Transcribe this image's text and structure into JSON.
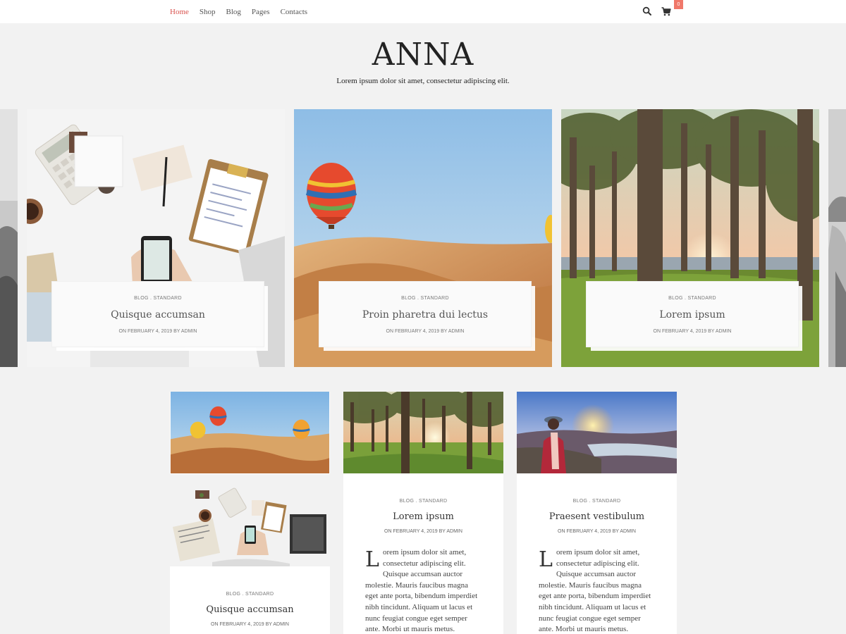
{
  "nav": {
    "items": [
      {
        "label": "Home",
        "active": true
      },
      {
        "label": "Shop"
      },
      {
        "label": "Blog"
      },
      {
        "label": "Pages"
      },
      {
        "label": "Contacts"
      }
    ],
    "cart_count": "0",
    "accent_color": "#d9534f",
    "badge_color": "#f0786a",
    "icons": [
      "search-icon",
      "cart-icon"
    ]
  },
  "header": {
    "logo": "ANNA",
    "tagline": "Lorem ipsum dolor sit amet, consectetur adipiscing elit."
  },
  "slider": [
    {
      "category": "BLOG",
      "category2": "STANDARD",
      "title": "Quisque accumsan",
      "meta": "ON FEBRUARY 4, 2019 BY ADMIN",
      "image": "desk with calculator, clipboard and phone"
    },
    {
      "category": "BLOG",
      "category2": "STANDARD",
      "title": "Proin pharetra dui lectus",
      "meta": "ON FEBRUARY 4, 2019 BY ADMIN",
      "image": "hot air balloons over desert"
    },
    {
      "category": "BLOG",
      "category2": "STANDARD",
      "title": "Lorem ipsum",
      "meta": "ON FEBRUARY 4, 2019 BY ADMIN",
      "image": "forest at sunset"
    }
  ],
  "posts": [
    {
      "image": "hot air balloons over desert"
    },
    {
      "category": "BLOG",
      "category2": "STANDARD",
      "title": "Quisque accumsan",
      "meta": "ON FEBRUARY 4, 2019 BY ADMIN",
      "image": "desk with laptop and phone"
    },
    {
      "category": "BLOG",
      "category2": "STANDARD",
      "title": "Lorem ipsum",
      "meta": "ON FEBRUARY 4, 2019 BY ADMIN",
      "image": "forest at sunset",
      "dropcap": "L",
      "excerpt_lines": [
        "orem ipsum dolor sit amet,",
        "consectetur adipiscing elit.",
        "Quisque accumsan auctor",
        "molestie. Mauris faucibus magna",
        "eget ante porta, bibendum imperdiet",
        "nibh tincidunt. Aliquam ut lacus et",
        "nunc feugiat congue eget semper",
        "ante. Morbi ut mauris metus."
      ]
    },
    {
      "category": "BLOG",
      "category2": "STANDARD",
      "title": "Praesent vestibulum",
      "meta": "ON FEBRUARY 4, 2019 BY ADMIN",
      "image": "woman in hat watching sunset",
      "dropcap": "L",
      "excerpt_lines": [
        "orem ipsum dolor sit amet,",
        "consectetur adipiscing elit.",
        "Quisque accumsan auctor",
        "molestie. Mauris faucibus magna",
        "eget ante porta, bibendum imperdiet",
        "nibh tincidunt. Aliquam ut lacus et",
        "nunc feugiat congue eget semper",
        "ante. Morbi ut mauris metus."
      ]
    }
  ]
}
